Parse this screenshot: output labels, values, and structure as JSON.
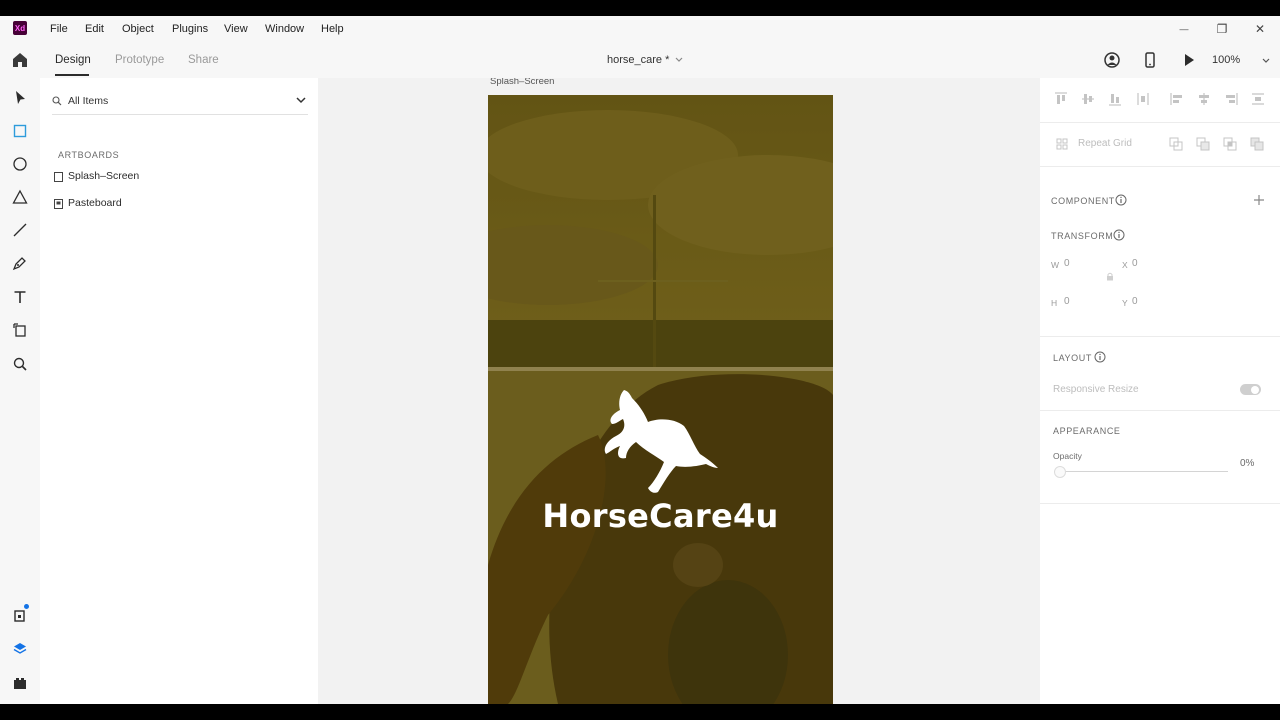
{
  "app": {
    "logo_text": "Xd",
    "brand_color": "#470137",
    "brand_text_color": "#ff61f6"
  },
  "menu": [
    "File",
    "Edit",
    "Object",
    "Plugins",
    "View",
    "Window",
    "Help"
  ],
  "window_controls": {
    "minimize": "—",
    "maximize": "❐",
    "close": "✕"
  },
  "tabs": [
    {
      "label": "Design",
      "active": true
    },
    {
      "label": "Prototype",
      "active": false
    },
    {
      "label": "Share",
      "active": false
    }
  ],
  "document": {
    "title": "horse_care *"
  },
  "header_right": {
    "zoom": "100%"
  },
  "layers": {
    "filter_label": "All Items",
    "section_title": "ARTBOARDS",
    "items": [
      {
        "label": "Splash–Screen",
        "icon": "artboard-icon"
      },
      {
        "label": "Pasteboard",
        "icon": "pasteboard-icon"
      }
    ]
  },
  "canvas": {
    "artboard_label": "Splash–Screen",
    "brand_text": "HorseCare4u",
    "overlay_color": "#6b5a12"
  },
  "properties": {
    "repeat_grid": "Repeat Grid",
    "component_title": "COMPONENT",
    "transform_title": "TRANSFORM",
    "w_label": "W",
    "w_value": "0",
    "x_label": "X",
    "x_value": "0",
    "h_label": "H",
    "h_value": "0",
    "y_label": "Y",
    "y_value": "0",
    "layout_title": "LAYOUT",
    "responsive_resize": "Responsive Resize",
    "appearance_title": "APPEARANCE",
    "opacity_label": "Opacity",
    "opacity_value": "0%"
  }
}
